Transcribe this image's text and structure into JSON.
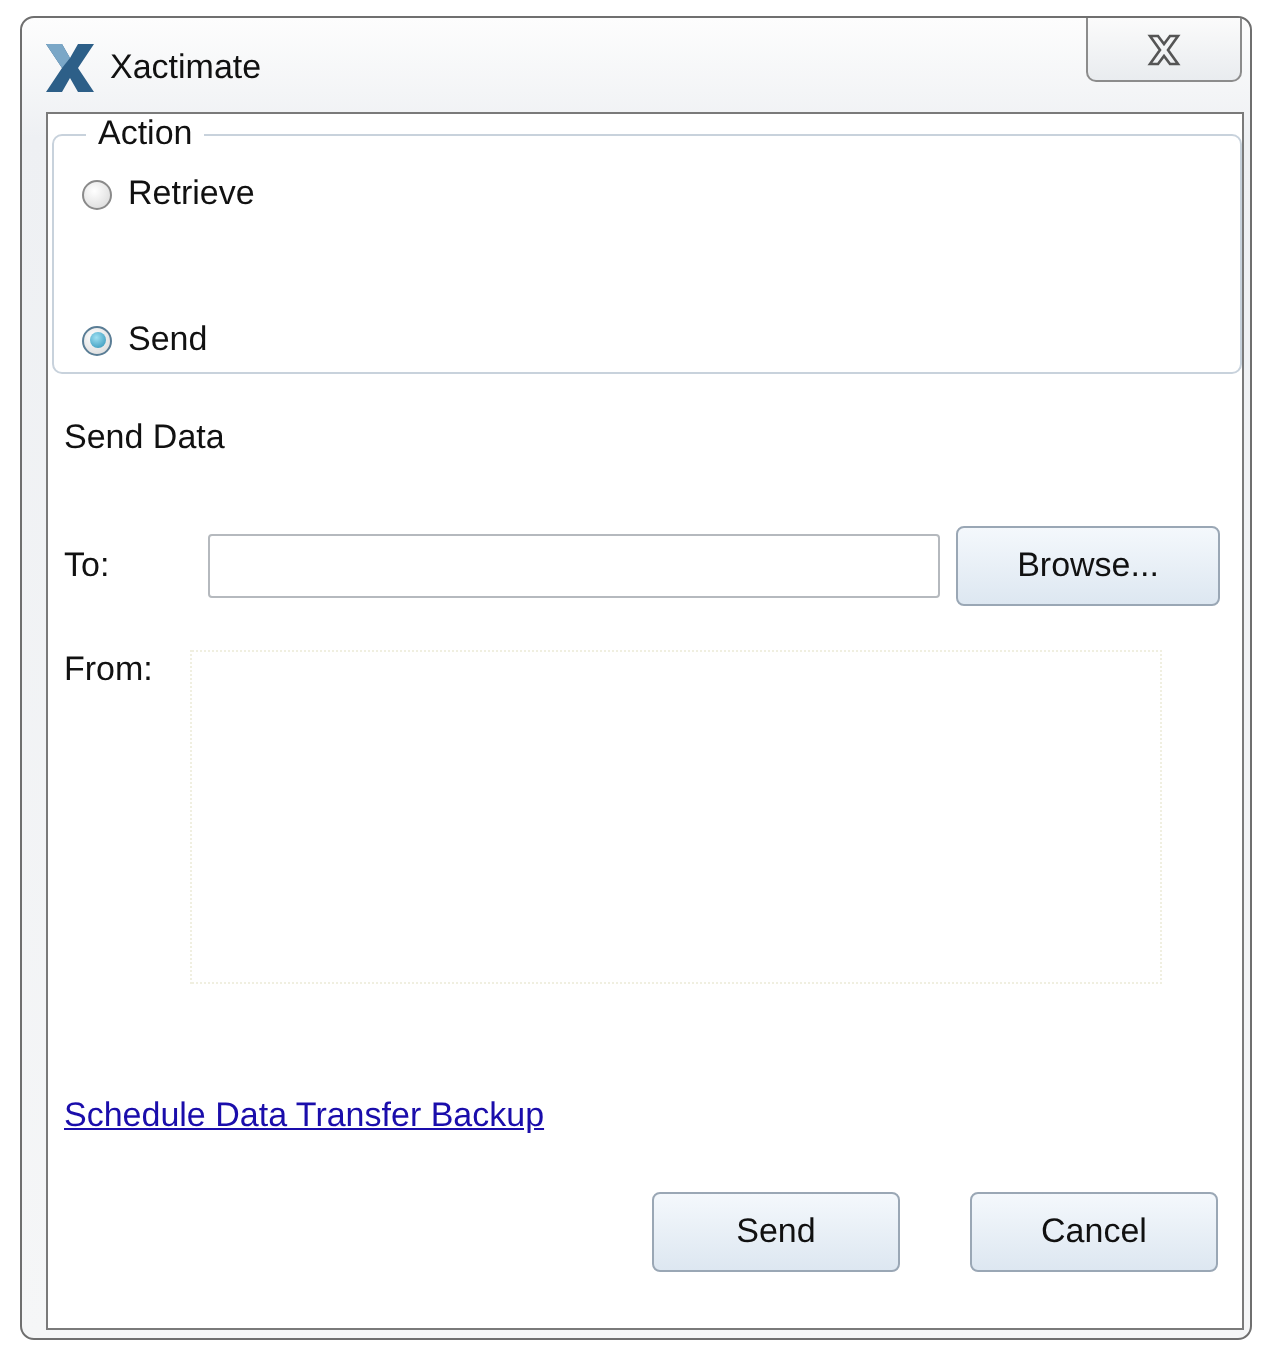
{
  "window": {
    "title": "Xactimate"
  },
  "action_group": {
    "label": "Action",
    "options": [
      {
        "label": "Retrieve",
        "selected": false
      },
      {
        "label": "Send",
        "selected": true
      }
    ]
  },
  "section_title": "Send Data",
  "to": {
    "label": "To:",
    "button": "Browse..."
  },
  "from": {
    "label": "From:"
  },
  "link": "Schedule Data Transfer Backup",
  "buttons": [
    "Send",
    "Cancel"
  ]
}
